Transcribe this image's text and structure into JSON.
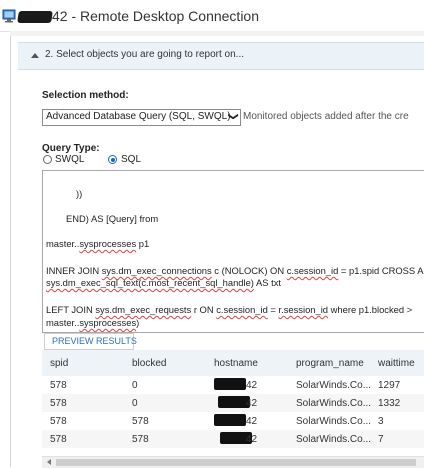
{
  "window": {
    "title": "42 - Remote Desktop Connection",
    "icon": "remote-desktop-icon"
  },
  "section": {
    "title": "2. Select objects you are going to report on...",
    "icon": "collapse-arrow-icon"
  },
  "selection_method": {
    "label": "Selection method:",
    "value": "Advanced Database Query (SQL, SWQL)",
    "chevron": "❯",
    "note": "Monitored objects added after the cre"
  },
  "query_type": {
    "label": "Query Type:",
    "options": [
      {
        "label": "SWQL",
        "checked": false
      },
      {
        "label": "SQL",
        "checked": true
      }
    ]
  },
  "query_text": {
    "line1": "))",
    "line2": "END) AS [Query] from",
    "line3_a": "master..",
    "line3_b": "sysprocesses",
    "line3_c": " p1",
    "line4_a": "INNER JOIN ",
    "line4_b": "sys.dm_exec_connections",
    "line4_c": " c (NOLOCK) ON ",
    "line4_d": "c.session_id",
    "line4_e": " = p1.spid CROSS A",
    "line5_a": "sys.dm_exec_sql_text(c.most_recent_sql_handle)",
    "line5_b": " AS txt",
    "line6_a": "LEFT JOIN ",
    "line6_b": "sys.dm_exec_requests",
    "line6_c": " r ON ",
    "line6_d": "c.session_id",
    "line6_e": " = ",
    "line6_f": "r.session_id",
    "line6_g": " where p1.blocked >",
    "line7_a": "master..",
    "line7_b": "sysprocesses",
    "line7_c": ")"
  },
  "preview_button": {
    "label": "PREVIEW RESULTS"
  },
  "results": {
    "columns": [
      "spid",
      "blocked",
      "hostname",
      "program_name",
      "waittime"
    ],
    "rows": [
      {
        "spid": "578",
        "blocked": "0",
        "hostname_suffix": "42",
        "program_name": "SolarWinds.Co...",
        "waittime": "1297"
      },
      {
        "spid": "578",
        "blocked": "0",
        "hostname_suffix": "42",
        "program_name": "SolarWinds.Co...",
        "waittime": "1332"
      },
      {
        "spid": "578",
        "blocked": "578",
        "hostname_suffix": "42",
        "program_name": "SolarWinds.Co...",
        "waittime": "3"
      },
      {
        "spid": "578",
        "blocked": "578",
        "hostname_suffix": "42",
        "program_name": "SolarWinds.Co...",
        "waittime": "7"
      }
    ]
  }
}
